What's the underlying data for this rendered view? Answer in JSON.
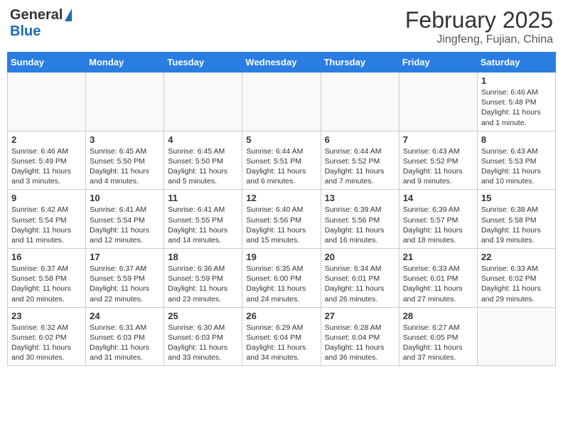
{
  "header": {
    "logo_general": "General",
    "logo_blue": "Blue",
    "title": "February 2025",
    "location": "Jingfeng, Fujian, China"
  },
  "weekdays": [
    "Sunday",
    "Monday",
    "Tuesday",
    "Wednesday",
    "Thursday",
    "Friday",
    "Saturday"
  ],
  "weeks": [
    [
      {
        "day": "",
        "info": ""
      },
      {
        "day": "",
        "info": ""
      },
      {
        "day": "",
        "info": ""
      },
      {
        "day": "",
        "info": ""
      },
      {
        "day": "",
        "info": ""
      },
      {
        "day": "",
        "info": ""
      },
      {
        "day": "1",
        "info": "Sunrise: 6:46 AM\nSunset: 5:48 PM\nDaylight: 11 hours and 1 minute."
      }
    ],
    [
      {
        "day": "2",
        "info": "Sunrise: 6:46 AM\nSunset: 5:49 PM\nDaylight: 11 hours and 3 minutes."
      },
      {
        "day": "3",
        "info": "Sunrise: 6:45 AM\nSunset: 5:50 PM\nDaylight: 11 hours and 4 minutes."
      },
      {
        "day": "4",
        "info": "Sunrise: 6:45 AM\nSunset: 5:50 PM\nDaylight: 11 hours and 5 minutes."
      },
      {
        "day": "5",
        "info": "Sunrise: 6:44 AM\nSunset: 5:51 PM\nDaylight: 11 hours and 6 minutes."
      },
      {
        "day": "6",
        "info": "Sunrise: 6:44 AM\nSunset: 5:52 PM\nDaylight: 11 hours and 7 minutes."
      },
      {
        "day": "7",
        "info": "Sunrise: 6:43 AM\nSunset: 5:52 PM\nDaylight: 11 hours and 9 minutes."
      },
      {
        "day": "8",
        "info": "Sunrise: 6:43 AM\nSunset: 5:53 PM\nDaylight: 11 hours and 10 minutes."
      }
    ],
    [
      {
        "day": "9",
        "info": "Sunrise: 6:42 AM\nSunset: 5:54 PM\nDaylight: 11 hours and 11 minutes."
      },
      {
        "day": "10",
        "info": "Sunrise: 6:41 AM\nSunset: 5:54 PM\nDaylight: 11 hours and 12 minutes."
      },
      {
        "day": "11",
        "info": "Sunrise: 6:41 AM\nSunset: 5:55 PM\nDaylight: 11 hours and 14 minutes."
      },
      {
        "day": "12",
        "info": "Sunrise: 6:40 AM\nSunset: 5:56 PM\nDaylight: 11 hours and 15 minutes."
      },
      {
        "day": "13",
        "info": "Sunrise: 6:39 AM\nSunset: 5:56 PM\nDaylight: 11 hours and 16 minutes."
      },
      {
        "day": "14",
        "info": "Sunrise: 6:39 AM\nSunset: 5:57 PM\nDaylight: 11 hours and 18 minutes."
      },
      {
        "day": "15",
        "info": "Sunrise: 6:38 AM\nSunset: 5:58 PM\nDaylight: 11 hours and 19 minutes."
      }
    ],
    [
      {
        "day": "16",
        "info": "Sunrise: 6:37 AM\nSunset: 5:58 PM\nDaylight: 11 hours and 20 minutes."
      },
      {
        "day": "17",
        "info": "Sunrise: 6:37 AM\nSunset: 5:59 PM\nDaylight: 11 hours and 22 minutes."
      },
      {
        "day": "18",
        "info": "Sunrise: 6:36 AM\nSunset: 5:59 PM\nDaylight: 11 hours and 23 minutes."
      },
      {
        "day": "19",
        "info": "Sunrise: 6:35 AM\nSunset: 6:00 PM\nDaylight: 11 hours and 24 minutes."
      },
      {
        "day": "20",
        "info": "Sunrise: 6:34 AM\nSunset: 6:01 PM\nDaylight: 11 hours and 26 minutes."
      },
      {
        "day": "21",
        "info": "Sunrise: 6:33 AM\nSunset: 6:01 PM\nDaylight: 11 hours and 27 minutes."
      },
      {
        "day": "22",
        "info": "Sunrise: 6:33 AM\nSunset: 6:02 PM\nDaylight: 11 hours and 29 minutes."
      }
    ],
    [
      {
        "day": "23",
        "info": "Sunrise: 6:32 AM\nSunset: 6:02 PM\nDaylight: 11 hours and 30 minutes."
      },
      {
        "day": "24",
        "info": "Sunrise: 6:31 AM\nSunset: 6:03 PM\nDaylight: 11 hours and 31 minutes."
      },
      {
        "day": "25",
        "info": "Sunrise: 6:30 AM\nSunset: 6:03 PM\nDaylight: 11 hours and 33 minutes."
      },
      {
        "day": "26",
        "info": "Sunrise: 6:29 AM\nSunset: 6:04 PM\nDaylight: 11 hours and 34 minutes."
      },
      {
        "day": "27",
        "info": "Sunrise: 6:28 AM\nSunset: 6:04 PM\nDaylight: 11 hours and 36 minutes."
      },
      {
        "day": "28",
        "info": "Sunrise: 6:27 AM\nSunset: 6:05 PM\nDaylight: 11 hours and 37 minutes."
      },
      {
        "day": "",
        "info": ""
      }
    ]
  ]
}
